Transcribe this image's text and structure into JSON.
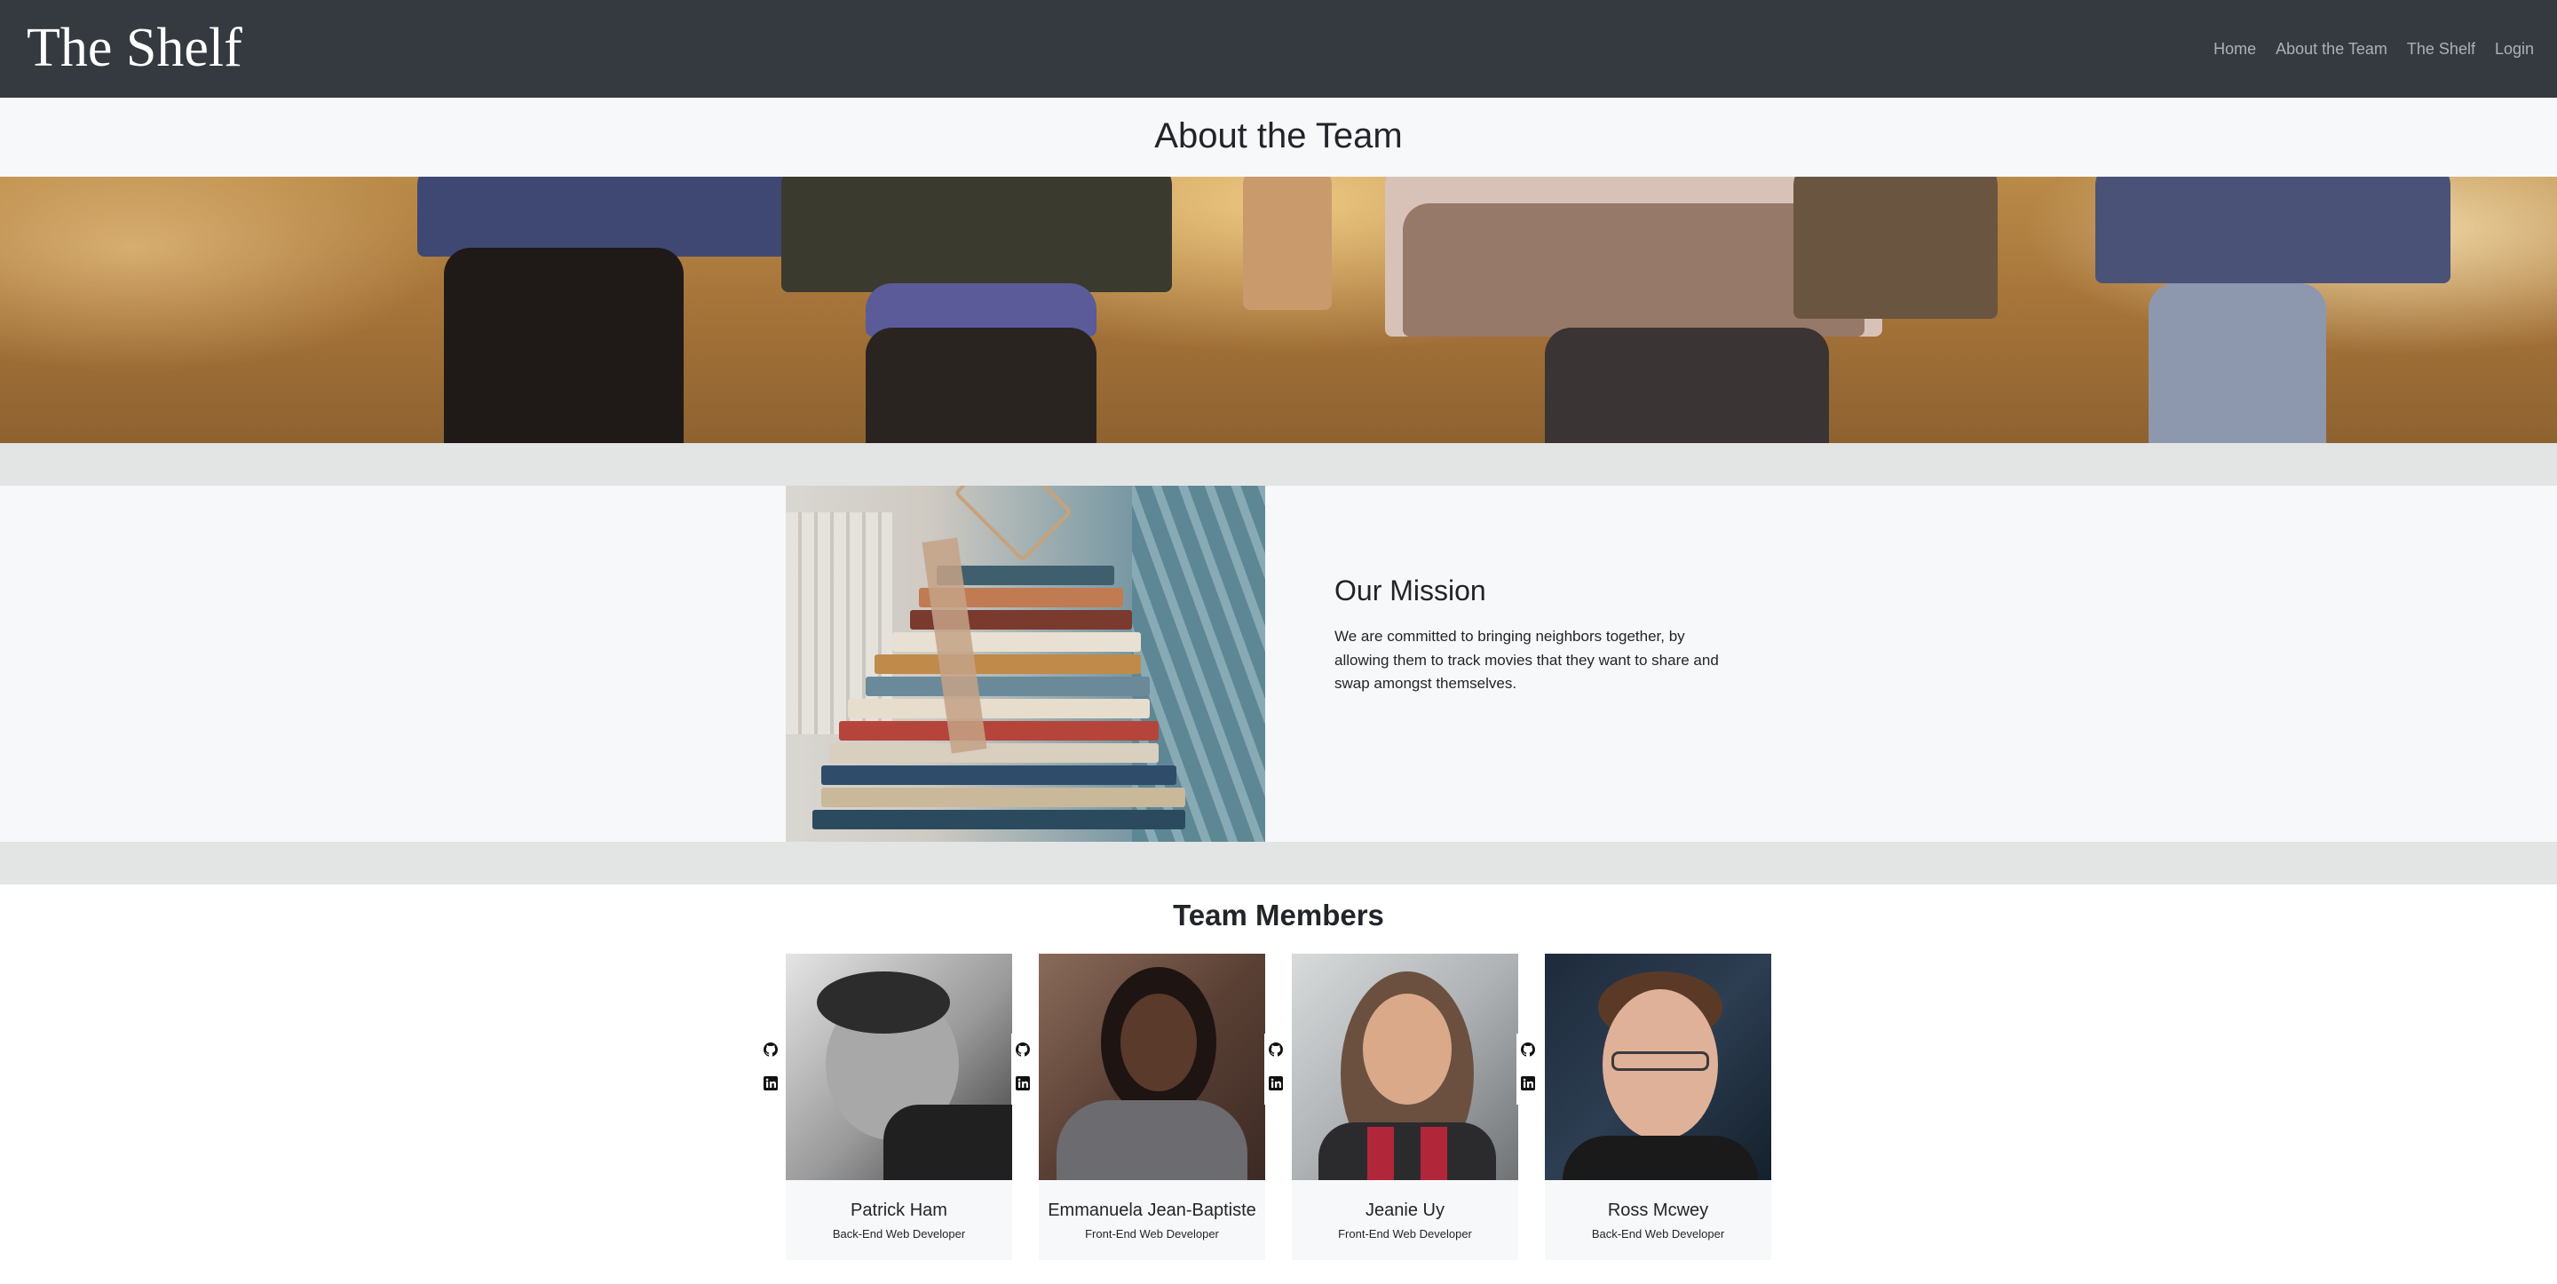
{
  "navbar": {
    "brand": "The Shelf",
    "links": [
      "Home",
      "About the Team",
      "The Shelf",
      "Login"
    ]
  },
  "page": {
    "title": "About the Team"
  },
  "mission": {
    "title": "Our Mission",
    "text": "We are committed to bringing neighbors together, by allowing them to track movies that they want to share and swap amongst themselves."
  },
  "team": {
    "title": "Team Members",
    "members": [
      {
        "name": "Patrick Ham",
        "role": "Back-End Web Developer"
      },
      {
        "name": "Emmanuela Jean-Baptiste",
        "role": "Front-End Web Developer"
      },
      {
        "name": "Jeanie Uy",
        "role": "Front-End Web Developer"
      },
      {
        "name": "Ross Mcwey",
        "role": "Back-End Web Developer"
      }
    ]
  },
  "icons": [
    "github-icon",
    "linkedin-icon"
  ],
  "colors": {
    "navbar": "#343a40",
    "page_bg": "#f7f8fa",
    "band": "#e3e5e4"
  }
}
